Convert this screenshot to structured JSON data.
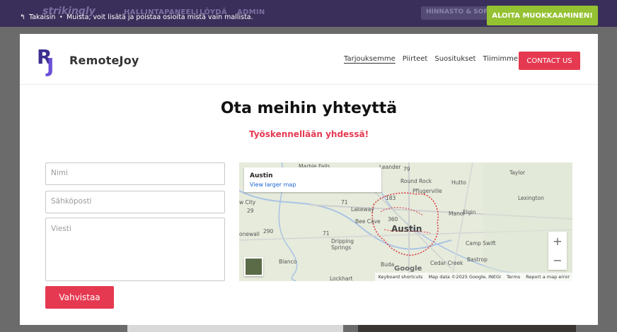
{
  "editor_bar": {
    "logo": "strikingly",
    "nav_dim": [
      "HALLINTAPANEELI",
      "LÖYDÄ",
      "ADMIN"
    ],
    "pricing": "HINNASTO & SOPI",
    "back_label": "Takaisin",
    "separator": "•",
    "hint": "Muista, voit lisätä ja poistaa osioita mistä vain mallista.",
    "start_editing": "ALOITA MUOKKAAMINEN!"
  },
  "site": {
    "brand_mark_r": "R",
    "brand_mark_j": "J",
    "brand_name": "RemoteJoy",
    "nav": [
      "Tarjouksemme",
      "Piirteet",
      "Suositukset",
      "Tiimimme"
    ],
    "contact_button": "CONTACT US"
  },
  "section": {
    "title": "Ota meihin yhteyttä",
    "subtitle": "Työskennellään yhdessä!"
  },
  "form": {
    "name_placeholder": "Nimi",
    "email_placeholder": "Sähköposti",
    "message_placeholder": "Viesti",
    "submit": "Vahvistaa"
  },
  "map": {
    "place": "Austin",
    "larger_map": "View larger map",
    "city_label": "Austin",
    "labels": [
      "Marble Falls",
      "Leander",
      "Round Rock",
      "Pflugerville",
      "Hutto",
      "Taylor",
      "Lexington",
      "w City",
      "Lakeway",
      "Bee Cave",
      "Manor",
      "Elgin",
      "onewall",
      "Dripping Springs",
      "Camp Swift",
      "Blanco",
      "Buda",
      "Cedar Creek",
      "Bastrop",
      "Lockhart"
    ],
    "road_numbers": [
      "29",
      "71",
      "79",
      "183",
      "290",
      "360",
      "71"
    ],
    "zoom_in": "+",
    "zoom_out": "−",
    "google": "Google",
    "attribution": [
      "Keyboard shortcuts",
      "Map data ©2025 Google, INEGI",
      "Terms",
      "Report a map error"
    ]
  },
  "colors": {
    "accent": "#e53951",
    "editor_bar": "#3a2f5a",
    "start_button": "#95c233",
    "brand_r": "#3a2f8f",
    "brand_j": "#6b4fd8"
  }
}
